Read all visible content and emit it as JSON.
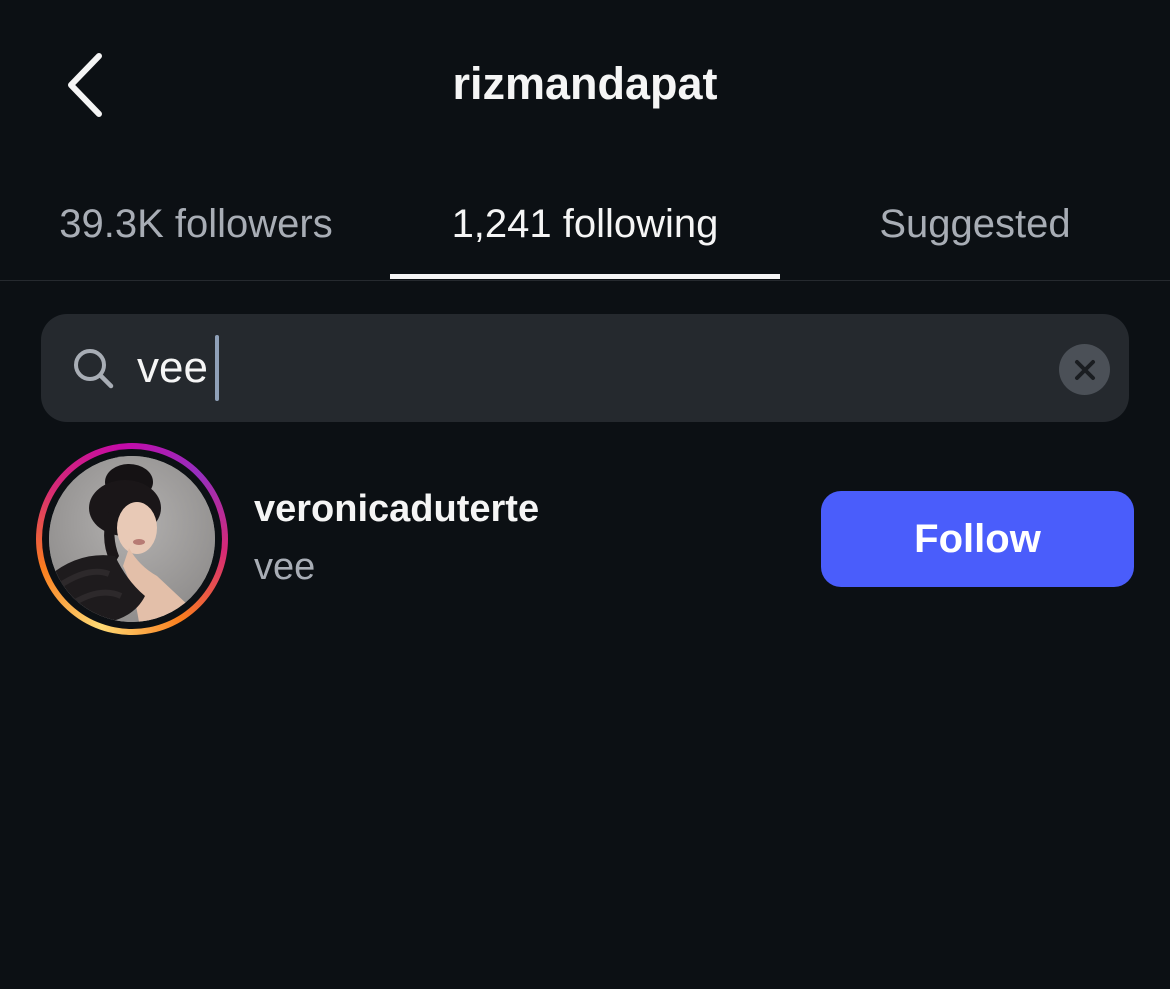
{
  "header": {
    "title": "rizmandapat",
    "back_icon": "chevron-left-icon"
  },
  "tabs": [
    {
      "label": "39.3K followers",
      "active": false
    },
    {
      "label": "1,241 following",
      "active": true
    },
    {
      "label": "Suggested",
      "active": false
    }
  ],
  "search": {
    "value": "vee",
    "search_icon": "search-icon",
    "clear_icon": "clear-icon"
  },
  "results": [
    {
      "username": "veronicaduterte",
      "full_name": "vee",
      "has_story": true,
      "button_label": "Follow"
    }
  ],
  "colors": {
    "background": "#0c1014",
    "search_bg": "#25292e",
    "follow_button": "#4a5dfb",
    "secondary_text": "#a8adb5"
  }
}
